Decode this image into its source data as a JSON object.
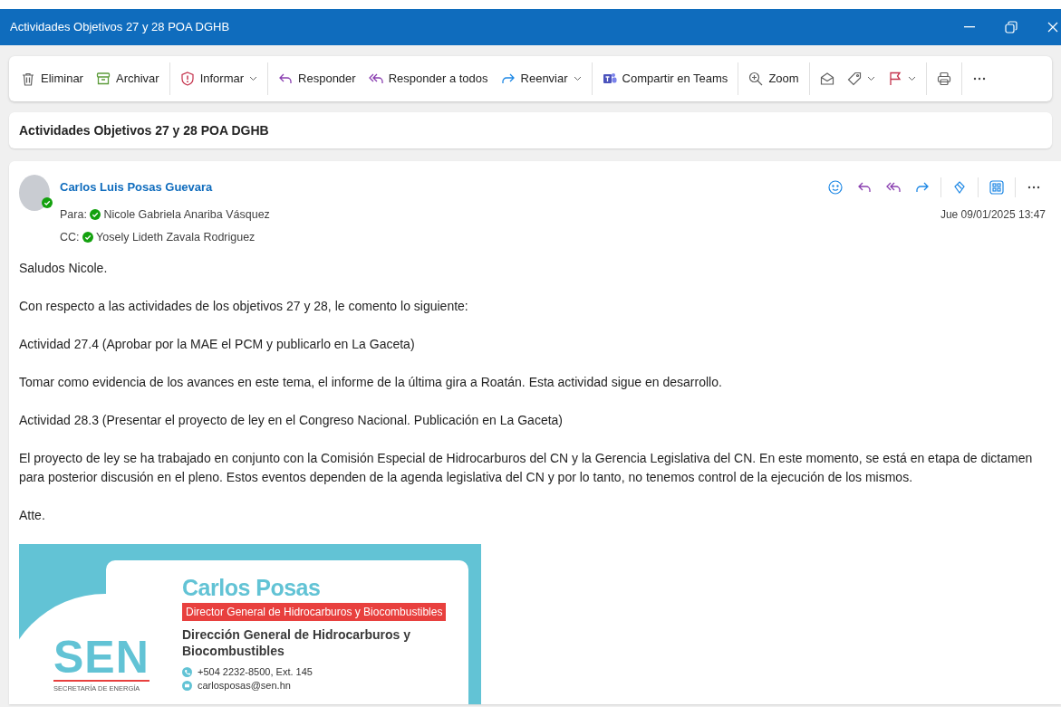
{
  "window": {
    "title": "Actividades Objetivos 27 y 28 POA DGHB"
  },
  "toolbar": [
    [
      {
        "label": "Eliminar",
        "dropdown": false
      },
      {
        "label": "Archivar",
        "dropdown": false
      }
    ],
    [
      {
        "label": "Informar",
        "dropdown": true
      }
    ],
    [
      {
        "label": "Responder",
        "dropdown": false
      },
      {
        "label": "Responder a todos",
        "dropdown": false
      },
      {
        "label": "Reenviar",
        "dropdown": true
      }
    ],
    [
      {
        "label": "Compartir en Teams",
        "dropdown": false
      }
    ],
    [
      {
        "label": "Zoom",
        "dropdown": false
      }
    ],
    [
      {
        "dropdown": false
      },
      {
        "dropdown": true
      },
      {
        "dropdown": true
      }
    ],
    [
      {
        "dropdown": false
      }
    ],
    [
      {
        "dropdown": false
      }
    ]
  ],
  "subject": "Actividades Objetivos 27 y 28 POA DGHB",
  "message": {
    "sender": {
      "name": "Carlos Luis Posas Guevara",
      "online": true
    },
    "to": {
      "label": "Para:",
      "name": "Nicole Gabriela Anariba Vásquez",
      "online": true
    },
    "cc": {
      "label": "CC:",
      "name": "Yosely Lideth Zavala Rodriguez",
      "online": true
    },
    "date": "Jue 09/01/2025 13:47",
    "body": [
      "Saludos Nicole.",
      "Con respecto a las actividades de los objetivos 27 y 28, le comento lo siguiente:",
      "Actividad 27.4 (Aprobar por la MAE el PCM y publicarlo en La Gaceta)",
      "Tomar como evidencia de los avances en este tema, el informe de la última gira a Roatán. Esta actividad sigue en desarrollo.",
      "Actividad 28.3 (Presentar el proyecto de ley en el Congreso Nacional. Publicación en La Gaceta)",
      "El proyecto de ley se ha trabajado en conjunto con la Comisión Especial de Hidrocarburos del CN y la Gerencia Legislativa del CN. En este momento, se está en etapa de dictamen para posterior discusión en el pleno. Estos eventos dependen de la agenda legislativa del CN y por lo tanto, no tenemos control de la ejecución de los mismos.",
      "Atte."
    ],
    "signature": {
      "logo": "SEN",
      "logo_subtitle": "SECRETARÍA DE ENERGÍA",
      "name": "Carlos Posas",
      "role": "Director General de Hidrocarburos y Biocombustibles",
      "department": "Dirección General de Hidrocarburos y Biocombustibles",
      "phone": "+504 2232-8500, Ext. 145",
      "email": "carlosposas@sen.hn"
    }
  }
}
